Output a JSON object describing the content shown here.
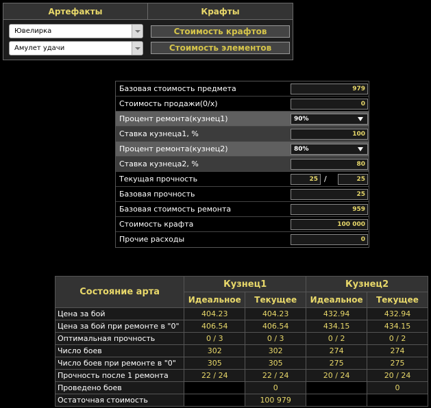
{
  "top": {
    "artifacts_header": "Артефакты",
    "crafts_header": "Крафты",
    "category_select": "Ювелирка",
    "item_select": "Амулет удачи",
    "craft_cost_button": "Стоимость крафтов",
    "element_cost_button": "Стоимость элементов"
  },
  "params": {
    "rows": [
      {
        "label": "Базовая стоимость предмета",
        "value": "979"
      },
      {
        "label": "Стоимость продажи(0/x)",
        "value": "0"
      },
      {
        "label": "Процент ремонта(кузнец1)",
        "value": "90%"
      },
      {
        "label": "Ставка кузнеца1, %",
        "value": "100"
      },
      {
        "label": "Процент ремонта(кузнец2)",
        "value": "80%"
      },
      {
        "label": "Ставка кузнеца2, %",
        "value": "80"
      },
      {
        "label": "Текущая прочность",
        "value": "25",
        "value2": "25",
        "sep": "/"
      },
      {
        "label": "Базовая прочность",
        "value": "25"
      },
      {
        "label": "Базовая стоимость ремонта",
        "value": "959"
      },
      {
        "label": "Стоимость крафта",
        "value": "100 000"
      },
      {
        "label": "Прочие расходы",
        "value": "0"
      }
    ]
  },
  "results": {
    "state_header": "Состояние арта",
    "smith1_header": "Кузнец1",
    "smith2_header": "Кузнец2",
    "ideal": "Идеальное",
    "current": "Текущее",
    "rows": [
      {
        "label": "Цена за бой",
        "v": [
          "404.23",
          "404.23",
          "432.94",
          "432.94"
        ]
      },
      {
        "label": "Цена за бой при ремонте в \"0\"",
        "v": [
          "406.54",
          "406.54",
          "434.15",
          "434.15"
        ]
      },
      {
        "label": "Оптимальная прочность",
        "v": [
          "0 / 3",
          "0 / 3",
          "0 / 2",
          "0 / 2"
        ]
      },
      {
        "label": "Число боев",
        "v": [
          "302",
          "302",
          "274",
          "274"
        ]
      },
      {
        "label": "Число боев при ремонте в \"0\"",
        "v": [
          "305",
          "305",
          "275",
          "275"
        ]
      },
      {
        "label": "Прочность после 1 ремонта",
        "v": [
          "22 / 24",
          "22 / 24",
          "20 / 24",
          "20 / 24"
        ]
      }
    ],
    "fights_done_label": "Проведено боев",
    "fights_done_1": "0",
    "fights_done_2": "0",
    "residual_label": "Остаточная стоимость",
    "residual_value": "100 979"
  }
}
